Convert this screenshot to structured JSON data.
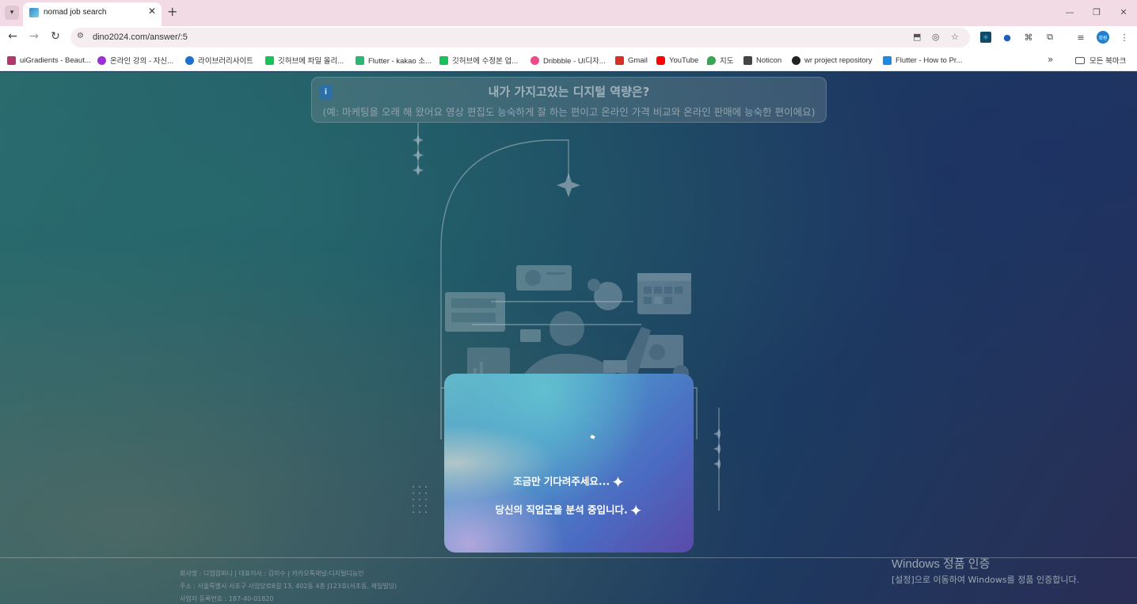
{
  "browser": {
    "tab_title": "nomad job search",
    "url": "dino2024.com/answer/:5",
    "bookmarks": [
      {
        "label": "uiGradients - Beaut...",
        "color": "#b23a6a"
      },
      {
        "label": "온라인 강의 - 자신...",
        "color": "#9b30d9"
      },
      {
        "label": "라이브러리사이트",
        "color": "#1e6fd0"
      },
      {
        "label": "깃허브에 파일 올리...",
        "color": "#19c159"
      },
      {
        "label": "Flutter - kakao 소...",
        "color": "#2bb673"
      },
      {
        "label": "깃허브에 수정본 업...",
        "color": "#19c159"
      },
      {
        "label": "Dribbble - UI디자...",
        "color": "#ea4c89"
      },
      {
        "label": "Gmail",
        "color": "#d93025"
      },
      {
        "label": "YouTube",
        "color": "#ff0000"
      },
      {
        "label": "지도",
        "color": "#34a853"
      },
      {
        "label": "Noticon",
        "color": "#444444"
      },
      {
        "label": "wr project repository",
        "color": "#222222"
      },
      {
        "label": "Flutter - How to Pr...",
        "color": "#1e88e5"
      }
    ],
    "all_bookmarks": "모든 북마크",
    "profile_initials": "회원"
  },
  "question": {
    "title": "내가 가지고있는 디지털 역량은?",
    "example": "(예: 마케팅을 오래 해 왔어요 영상 편집도 능숙하게 잘 하는 편이고 온라인 가격 비교와 온라인 판매에 능숙한 편이에요)"
  },
  "loading": {
    "line1": "조금만 기다려주세요...",
    "line2": "당신의 직업군을 분석 중입니다."
  },
  "footer": {
    "line1": "회사명 : 디엠컴퍼니 | 대표이사 : 김미수 | 카카오톡채널:디지털디능인",
    "line2": "주소 : 서울특별시 서초구 사임당로8길 13, 402동 4층 J123호(서초동, 제일빌딩)",
    "line3": "사업자 등록번호 : 187-40-01820"
  },
  "windows_watermark": {
    "title": "Windows 정품 인증",
    "subtitle": "[설정]으로 이동하여 Windows를 정품 인증합니다."
  }
}
